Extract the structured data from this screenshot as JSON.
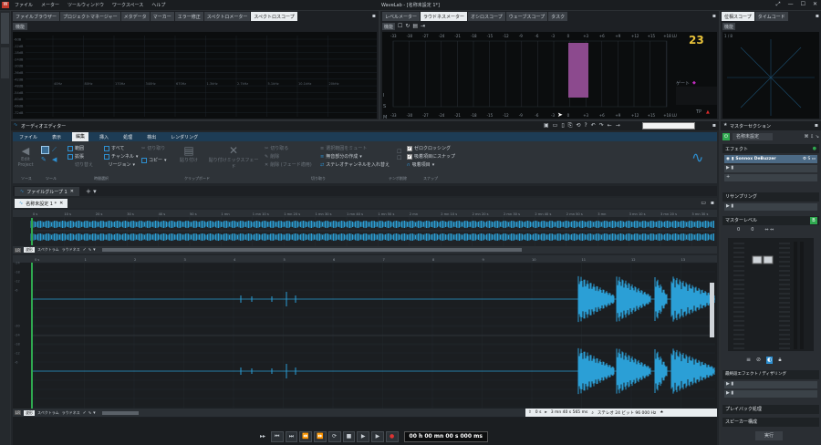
{
  "app": {
    "title": "WaveLab - [名称未設定 1*]",
    "menu": [
      "ファイル",
      "メーター",
      "ツールウィンドウ",
      "ワークスペース",
      "ヘルプ"
    ]
  },
  "top_tabs": [
    "ファイルブラウザー",
    "プロジェクトマネージャー",
    "メタデータ",
    "マーカー",
    "エラー修正",
    "スペクトロメーター",
    "スペクトロスコープ"
  ],
  "meter_tabs": [
    "レベルメーター",
    "ラウドネスメーター",
    "オシロスコープ",
    "ウェーブスコープ",
    "タスク"
  ],
  "phase_tabs": [
    "位相スコープ",
    "タイムコード"
  ],
  "func_label": "機能",
  "spectro": {
    "freqs": [
      "40Hz",
      "80Hz",
      "170Hz",
      "340Hz",
      "670Hz",
      "1.3kHz",
      "2.7kHz",
      "5.1kHz",
      "10.1kHz",
      "20kHz"
    ],
    "db": [
      "-6dB",
      "-12dB",
      "-18dB",
      "-24dB",
      "-30dB",
      "-36dB",
      "-42dB",
      "-48dB",
      "-54dB",
      "-60dB",
      "-66dB",
      "-72dB"
    ]
  },
  "loudness": {
    "scale": [
      "-33",
      "-30",
      "-27",
      "-24",
      "-21",
      "-18",
      "-15",
      "-12",
      "-9",
      "-6",
      "-3",
      "0",
      "+3",
      "+6",
      "+9",
      "+12",
      "+15",
      "+18 LU"
    ],
    "gate": "ゲート",
    "tp": "TP",
    "ch": [
      "I",
      "S",
      "M"
    ],
    "version": "23"
  },
  "phase": {
    "label": "1 / 8"
  },
  "editor": {
    "title": "オーディオエディター",
    "ribbon_tabs": [
      "ファイル",
      "表示",
      "編集",
      "挿入",
      "処理",
      "検出",
      "レンダリング"
    ],
    "groups": [
      "ソース",
      "ツール",
      "時間選択",
      "クリップボード",
      "切り取り",
      "テンポ削除",
      "スナップ"
    ],
    "source": [
      "Edit",
      "Project"
    ],
    "range": [
      "範囲",
      "拡張",
      "切り替え",
      "すべて",
      "チャンネル",
      "リージョン"
    ],
    "clip": [
      "切り取り",
      "コピー",
      "貼り付け",
      "貼り付けミックスフェード"
    ],
    "cut": [
      "切り取る",
      "削除",
      "削除 (フェード適用)"
    ],
    "silence": [
      "選択範囲をミュート",
      "無音部分の作成",
      "ステレオチャンネルを入れ替え"
    ],
    "snap": [
      "ゼロクロッシング",
      "吸着項目にスナップ",
      "吸着項目"
    ],
    "file_group": "ファイルグループ 1",
    "doc_tab": "名称未設定 1 *",
    "ruler": [
      "0 s",
      "10 s",
      "20 s",
      "30 s",
      "40 s",
      "50 s",
      "1 mn",
      "1 mn 10 s",
      "1 mn 20 s",
      "1 mn 30 s",
      "1 mn 40 s",
      "1 mn 50 s",
      "2 mn",
      "2 mn 10 s",
      "2 mn 20 s",
      "2 mn 30 s",
      "2 mn 40 s",
      "2 mn 50 s",
      "3 mn",
      "3 mn 10 s",
      "3 mn 20 s",
      "3 mn 30 s"
    ],
    "view_tabs": [
      "波形",
      "スペクトラム",
      "ラウドネス"
    ],
    "zoom_ruler": [
      "0 s",
      "1",
      "2",
      "3",
      "4",
      "5",
      "6",
      "7",
      "8",
      "9",
      "10",
      "11",
      "12",
      "13",
      "14"
    ],
    "db_top": [
      "-6",
      "-12",
      "-18",
      "-24",
      "-30"
    ],
    "db_bot": [
      "-6",
      "-12",
      "-18",
      "-24",
      "-30"
    ],
    "status": {
      "pos": "0 s",
      "len": "3 mn 40 s 565 ms",
      "fmt": "ステレオ 24 ビット 96 000 Hz"
    },
    "time": "00 h 00 mn 00 s 000 ms"
  },
  "master": {
    "title": "マスターセクション",
    "preset": "名称未設定",
    "effects": "エフェクト",
    "plugin": "Sonnox DeBuzzer",
    "resampling": "リサンプリング",
    "level": "マスターレベル",
    "levels": [
      "0",
      "0"
    ],
    "final": "最終段エフェクト / ディザリング",
    "playback": "プレイバック処理",
    "speaker": "スピーカー構成",
    "render": "実行"
  }
}
